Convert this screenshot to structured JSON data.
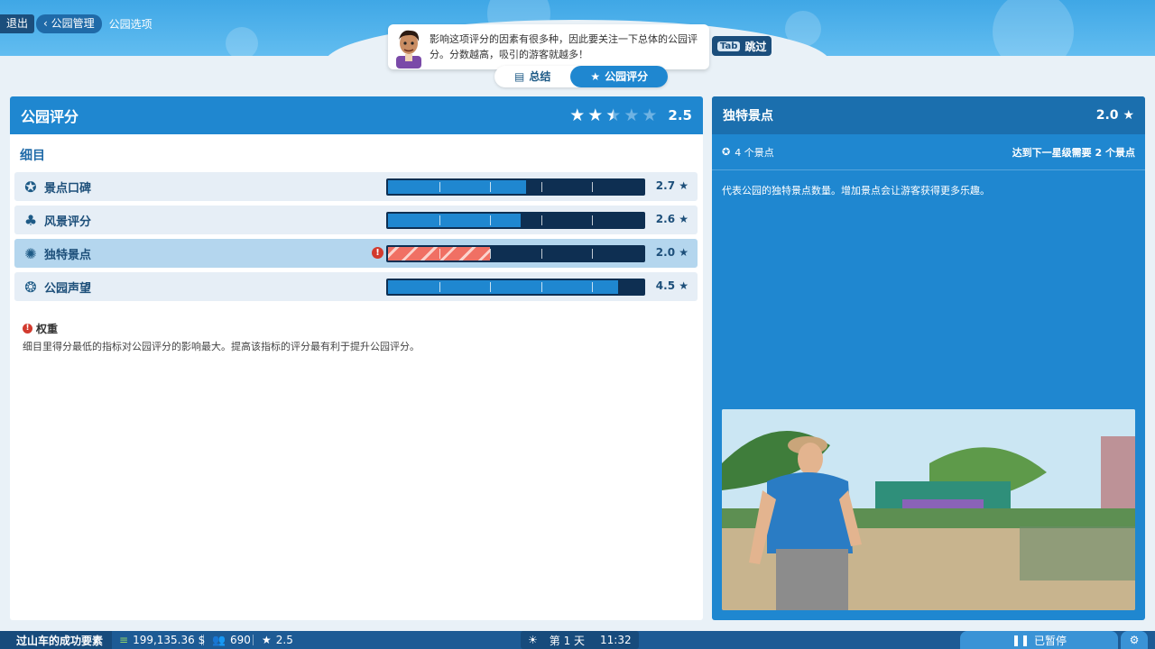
{
  "breadcrumb": {
    "exit": "退出",
    "park_management": "公园管理",
    "park_options": "公园选项"
  },
  "tip": {
    "text": "影响这项评分的因素有很多种，因此要关注一下总体的公园评分。分数越高，吸引的游客就越多！"
  },
  "skip": {
    "key": "Tab",
    "label": "跳过"
  },
  "tabs": [
    {
      "label": "总结",
      "icon": "document-icon",
      "active": false
    },
    {
      "label": "公园评分",
      "icon": "star-icon",
      "active": true
    }
  ],
  "left_panel": {
    "title": "公园评分",
    "rating_stars": 2.5,
    "score": "2.5",
    "section_title": "细目",
    "rows": [
      {
        "label": "景点口碑",
        "icon": "attraction-reputation-icon",
        "value": "2.7",
        "fill": 0.54,
        "selected": false,
        "warning": false
      },
      {
        "label": "风景评分",
        "icon": "tree-icon",
        "value": "2.6",
        "fill": 0.52,
        "selected": false,
        "warning": false
      },
      {
        "label": "独特景点",
        "icon": "unique-attraction-icon",
        "value": "2.0",
        "fill": 0.4,
        "selected": true,
        "warning": true
      },
      {
        "label": "公园声望",
        "icon": "reputation-icon",
        "value": "4.5",
        "fill": 0.9,
        "selected": false,
        "warning": false
      }
    ],
    "note": {
      "title": "权重",
      "body": "细目里得分最低的指标对公园评分的影响最大。提高该指标的评分最有利于提升公园评分。"
    }
  },
  "right_panel": {
    "title": "独特景点",
    "score": "2.0",
    "count": "4 个景点",
    "next_level": "达到下一星级需要 2 个景点",
    "description": "代表公园的独特景点数量。增加景点会让游客获得更多乐趣。"
  },
  "bottom_bar": {
    "goal": "过山车的成功要素",
    "money": "199,135.36 $",
    "guests": "690",
    "rating": "2.5",
    "day": "第 1 天",
    "clock": "11:32",
    "pause": "已暂停"
  },
  "colors": {
    "accent": "#1f87d0",
    "dark": "#0e2f52",
    "warning": "#d23a2e"
  }
}
